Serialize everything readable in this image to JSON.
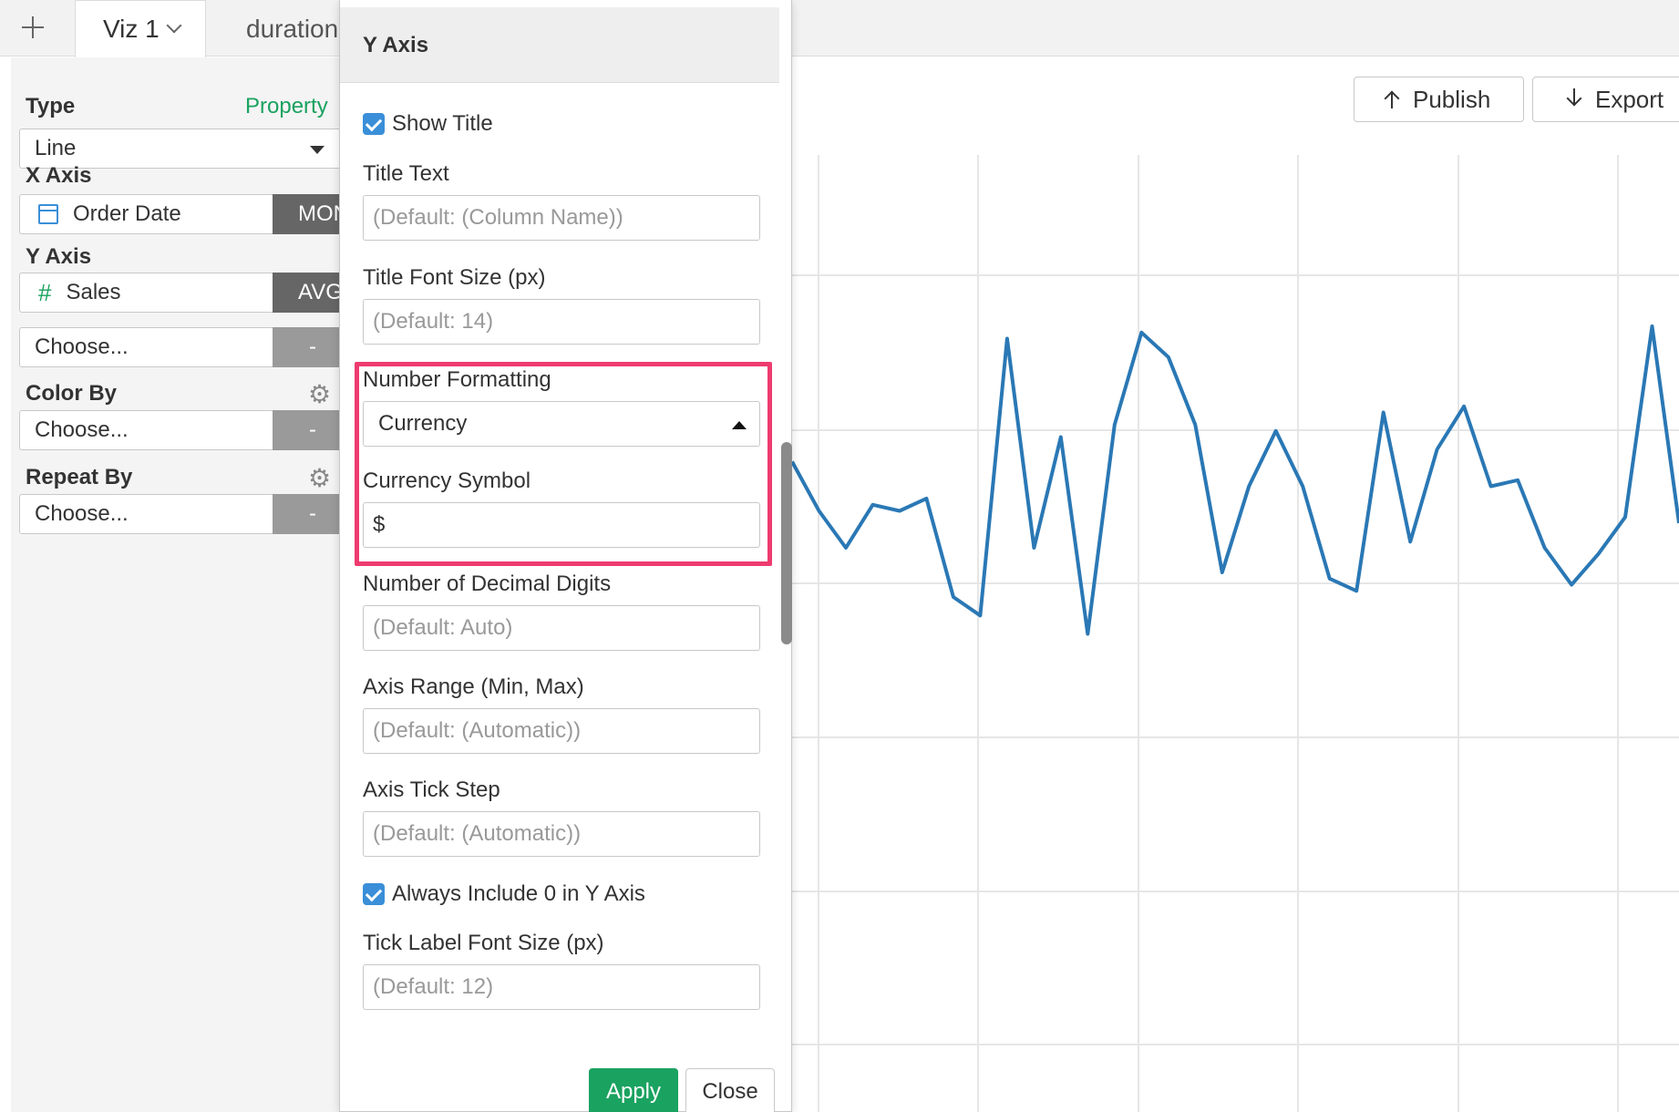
{
  "tabs": {
    "add_icon": "plus-icon",
    "active_label": "Viz 1",
    "second_label": "duration"
  },
  "left": {
    "type_label": "Type",
    "property_link": "Property",
    "type_value": "Line",
    "x_axis_label": "X Axis",
    "x_field": "Order Date",
    "x_agg": "MON",
    "y_axis_label": "Y Axis",
    "y_field": "Sales",
    "y_agg": "AVG",
    "y2_placeholder": "Choose...",
    "y2_agg": "-",
    "color_by_label": "Color By",
    "color_by_value": "Choose...",
    "color_by_agg": "-",
    "repeat_by_label": "Repeat By",
    "repeat_by_value": "Choose...",
    "repeat_by_agg": "-"
  },
  "toolbar": {
    "publish_label": "Publish",
    "export_label": "Export"
  },
  "popover": {
    "title": "Y Axis",
    "show_title_label": "Show Title",
    "title_text_label": "Title Text",
    "title_text_placeholder": "(Default: (Column Name))",
    "title_font_size_label": "Title Font Size (px)",
    "title_font_size_placeholder": "(Default: 14)",
    "number_formatting_label": "Number Formatting",
    "number_formatting_value": "Currency",
    "currency_symbol_label": "Currency Symbol",
    "currency_symbol_value": "$",
    "decimal_digits_label": "Number of Decimal Digits",
    "decimal_digits_placeholder": "(Default: Auto)",
    "axis_range_label": "Axis Range (Min, Max)",
    "axis_range_placeholder": "(Default: (Automatic))",
    "axis_tick_step_label": "Axis Tick Step",
    "axis_tick_step_placeholder": "(Default: (Automatic))",
    "include_zero_label": "Always Include 0 in Y Axis",
    "tick_label_font_size_label": "Tick Label Font Size (px)",
    "tick_label_font_size_placeholder": "(Default: 12)",
    "apply_label": "Apply",
    "close_label": "Close"
  },
  "colors": {
    "accent_green": "#1aa260",
    "line_blue": "#2a78b5",
    "highlight_pink": "#ee3b6f"
  },
  "chart_data": {
    "type": "line",
    "title": "",
    "xlabel": "",
    "ylabel": "",
    "grid": true,
    "series": [
      {
        "values": [
          42,
          34,
          28,
          35,
          34,
          36,
          20,
          17,
          62,
          28,
          46,
          14,
          48,
          63,
          59,
          48,
          24,
          38,
          47,
          38,
          23,
          21,
          50,
          29,
          44,
          51,
          38,
          39,
          28,
          22,
          27,
          33,
          64,
          32
        ]
      }
    ]
  }
}
